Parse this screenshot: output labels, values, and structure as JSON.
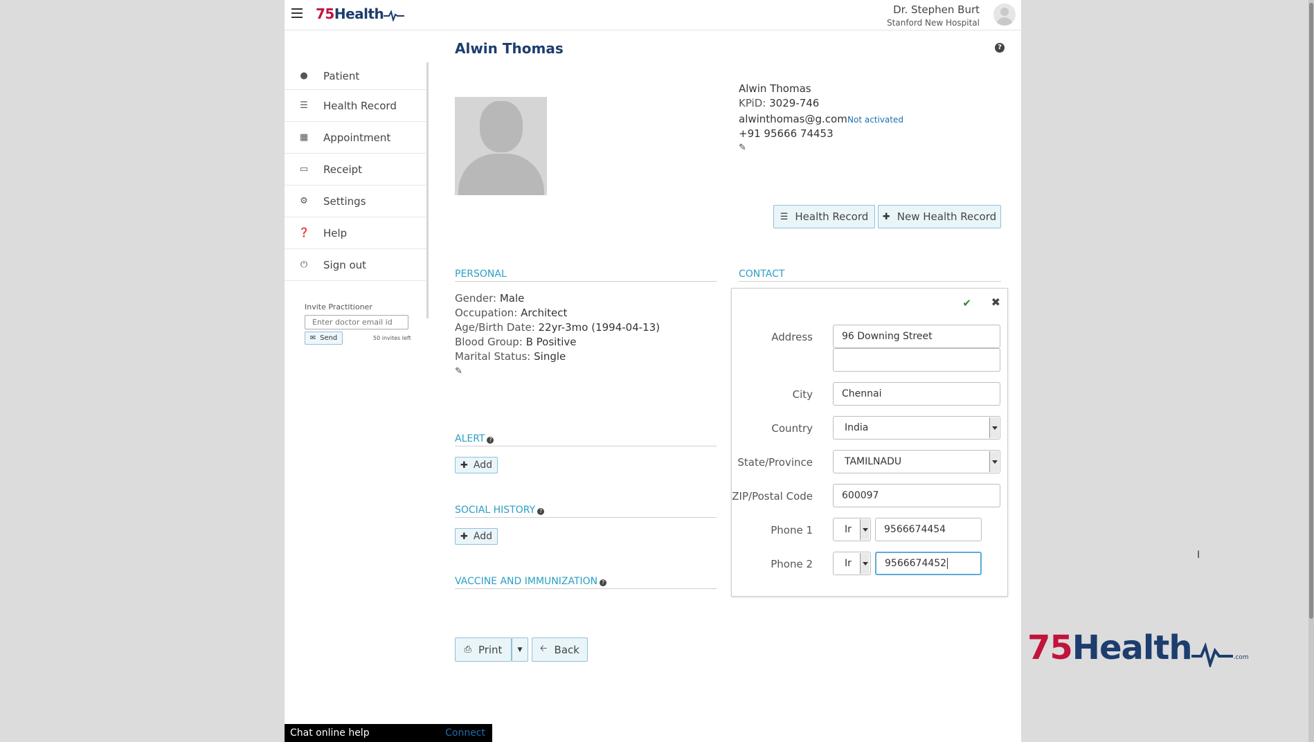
{
  "header": {
    "logo_text_number": "75",
    "logo_text_word": "Health",
    "user_name": "Dr. Stephen Burt",
    "user_org": "Stanford New Hospital"
  },
  "sidebar": {
    "items": [
      {
        "label": "Patient",
        "icon": "user-icon"
      },
      {
        "label": "Health Record",
        "icon": "list-icon"
      },
      {
        "label": "Appointment",
        "icon": "calendar-icon"
      },
      {
        "label": "Receipt",
        "icon": "credit-card-icon"
      },
      {
        "label": "Settings",
        "icon": "gear-icon"
      },
      {
        "label": "Help",
        "icon": "question-icon"
      },
      {
        "label": "Sign out",
        "icon": "power-icon"
      }
    ],
    "invite_label": "Invite Practitioner",
    "invite_placeholder": "Enter doctor email id",
    "send_label": "Send",
    "invites_left": "50 invites left"
  },
  "patient": {
    "title": "Alwin Thomas",
    "name": "Alwin Thomas",
    "kpid_label": "KPiD:",
    "kpid": "3029-746",
    "email": "alwinthomas@g.com",
    "email_status": "Not activated",
    "phone": "+91 95666 74453"
  },
  "actions": {
    "health_record": "Health Record",
    "new_health_record": "New Health Record",
    "print": "Print",
    "back": "Back"
  },
  "personal": {
    "heading": "PERSONAL",
    "gender_label": "Gender:",
    "gender": "Male",
    "occupation_label": "Occupation:",
    "occupation": "Architect",
    "age_label": "Age/Birth Date:",
    "age": "22yr-3mo (1994-04-13)",
    "blood_label": "Blood Group:",
    "blood": "B Positive",
    "marital_label": "Marital Status:",
    "marital": "Single"
  },
  "sections": {
    "contact": "CONTACT",
    "alert": "ALERT",
    "social_history": "SOCIAL HISTORY",
    "vaccine": "VACCINE AND IMMUNIZATION",
    "add": "Add"
  },
  "contact_form": {
    "address_label": "Address",
    "address1": "96 Downing Street",
    "address2": "",
    "city_label": "City",
    "city": "Chennai",
    "country_label": "Country",
    "country": "India",
    "state_label": "State/Province",
    "state": "TAMILNADU",
    "zip_label": "ZIP/Postal Code",
    "zip": "600097",
    "phone1_label": "Phone 1",
    "phone1_code": "Ir",
    "phone1": "9566674454",
    "phone2_label": "Phone 2",
    "phone2_code": "Ir",
    "phone2": "9566674452"
  },
  "chat": {
    "label": "Chat online help",
    "connect": "Connect"
  },
  "branding": {
    "big_logo_number": "75",
    "big_logo_word": "Health",
    "big_logo_suffix": ".com"
  }
}
